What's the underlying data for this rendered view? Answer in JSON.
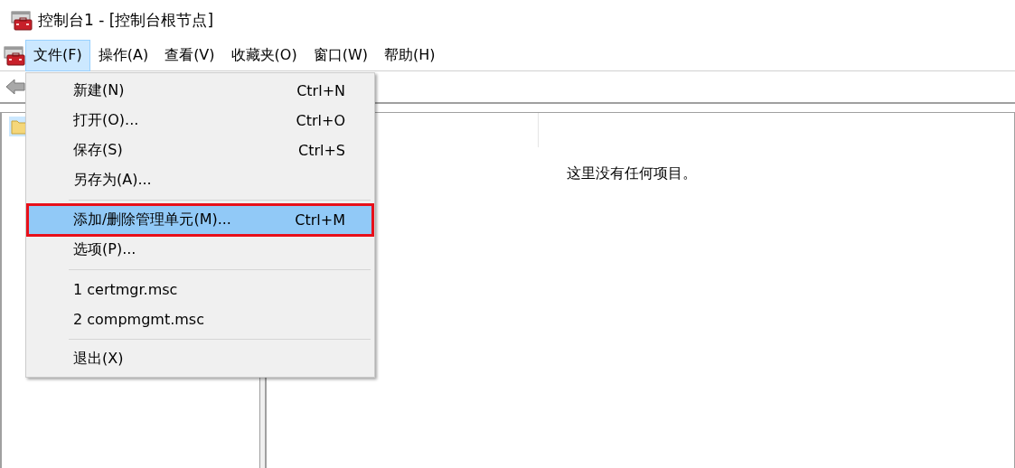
{
  "window": {
    "title": "控制台1 - [控制台根节点]"
  },
  "menubar": [
    {
      "label": "文件(F)",
      "selected": true
    },
    {
      "label": "操作(A)",
      "selected": false
    },
    {
      "label": "查看(V)",
      "selected": false
    },
    {
      "label": "收藏夹(O)",
      "selected": false
    },
    {
      "label": "窗口(W)",
      "selected": false
    },
    {
      "label": "帮助(H)",
      "selected": false
    }
  ],
  "menu": [
    {
      "kind": "item",
      "label": "新建(N)",
      "shortcut": "Ctrl+N",
      "selected": false,
      "annotated": false
    },
    {
      "kind": "item",
      "label": "打开(O)...",
      "shortcut": "Ctrl+O",
      "selected": false,
      "annotated": false
    },
    {
      "kind": "item",
      "label": "保存(S)",
      "shortcut": "Ctrl+S",
      "selected": false,
      "annotated": false
    },
    {
      "kind": "item",
      "label": "另存为(A)...",
      "selected": false,
      "annotated": false
    },
    {
      "kind": "separator"
    },
    {
      "kind": "item",
      "label": "添加/删除管理单元(M)...",
      "shortcut": "Ctrl+M",
      "selected": true,
      "annotated": true
    },
    {
      "kind": "item",
      "label": "选项(P)...",
      "selected": false,
      "annotated": false
    },
    {
      "kind": "separator"
    },
    {
      "kind": "item",
      "label": "1 certmgr.msc",
      "selected": false,
      "annotated": false
    },
    {
      "kind": "item",
      "label": "2 compmgmt.msc",
      "selected": false,
      "annotated": false
    },
    {
      "kind": "separator"
    },
    {
      "kind": "item",
      "label": "退出(X)",
      "selected": false,
      "annotated": false
    }
  ],
  "tree": {
    "root_selected": true
  },
  "results": {
    "empty_message": "这里没有任何项目。"
  }
}
